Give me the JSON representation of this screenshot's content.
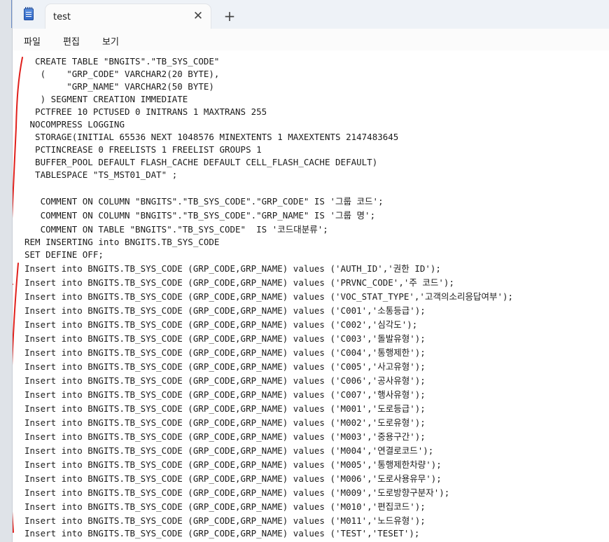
{
  "window": {
    "tab_title": "test",
    "close_glyph": "✕",
    "new_tab_glyph": "+"
  },
  "menu": {
    "items": [
      "파일",
      "편집",
      "보기"
    ]
  },
  "editor": {
    "lines": [
      "  CREATE TABLE \"BNGITS\".\"TB_SYS_CODE\"",
      "   (    \"GRP_CODE\" VARCHAR2(20 BYTE),",
      "        \"GRP_NAME\" VARCHAR2(50 BYTE)",
      "   ) SEGMENT CREATION IMMEDIATE",
      "  PCTFREE 10 PCTUSED 0 INITRANS 1 MAXTRANS 255",
      " NOCOMPRESS LOGGING",
      "  STORAGE(INITIAL 65536 NEXT 1048576 MINEXTENTS 1 MAXEXTENTS 2147483645",
      "  PCTINCREASE 0 FREELISTS 1 FREELIST GROUPS 1",
      "  BUFFER_POOL DEFAULT FLASH_CACHE DEFAULT CELL_FLASH_CACHE DEFAULT)",
      "  TABLESPACE \"TS_MST01_DAT\" ;",
      "",
      "   COMMENT ON COLUMN \"BNGITS\".\"TB_SYS_CODE\".\"GRP_CODE\" IS '그룹 코드';",
      "   COMMENT ON COLUMN \"BNGITS\".\"TB_SYS_CODE\".\"GRP_NAME\" IS '그룹 명';",
      "   COMMENT ON TABLE \"BNGITS\".\"TB_SYS_CODE\"  IS '코드대분류';",
      "REM INSERTING into BNGITS.TB_SYS_CODE",
      "SET DEFINE OFF;",
      "Insert into BNGITS.TB_SYS_CODE (GRP_CODE,GRP_NAME) values ('AUTH_ID','권한 ID');",
      "Insert into BNGITS.TB_SYS_CODE (GRP_CODE,GRP_NAME) values ('PRVNC_CODE','주 코드');",
      "Insert into BNGITS.TB_SYS_CODE (GRP_CODE,GRP_NAME) values ('VOC_STAT_TYPE','고객의소리응답여부');",
      "Insert into BNGITS.TB_SYS_CODE (GRP_CODE,GRP_NAME) values ('C001','소통등급');",
      "Insert into BNGITS.TB_SYS_CODE (GRP_CODE,GRP_NAME) values ('C002','심각도');",
      "Insert into BNGITS.TB_SYS_CODE (GRP_CODE,GRP_NAME) values ('C003','돌발유형');",
      "Insert into BNGITS.TB_SYS_CODE (GRP_CODE,GRP_NAME) values ('C004','통행제한');",
      "Insert into BNGITS.TB_SYS_CODE (GRP_CODE,GRP_NAME) values ('C005','사고유형');",
      "Insert into BNGITS.TB_SYS_CODE (GRP_CODE,GRP_NAME) values ('C006','공사유형');",
      "Insert into BNGITS.TB_SYS_CODE (GRP_CODE,GRP_NAME) values ('C007','행사유형');",
      "Insert into BNGITS.TB_SYS_CODE (GRP_CODE,GRP_NAME) values ('M001','도로등급');",
      "Insert into BNGITS.TB_SYS_CODE (GRP_CODE,GRP_NAME) values ('M002','도로유형');",
      "Insert into BNGITS.TB_SYS_CODE (GRP_CODE,GRP_NAME) values ('M003','중용구간');",
      "Insert into BNGITS.TB_SYS_CODE (GRP_CODE,GRP_NAME) values ('M004','연결로코드');",
      "Insert into BNGITS.TB_SYS_CODE (GRP_CODE,GRP_NAME) values ('M005','통행제한차량');",
      "Insert into BNGITS.TB_SYS_CODE (GRP_CODE,GRP_NAME) values ('M006','도로사용유무');",
      "Insert into BNGITS.TB_SYS_CODE (GRP_CODE,GRP_NAME) values ('M009','도로방향구분자');",
      "Insert into BNGITS.TB_SYS_CODE (GRP_CODE,GRP_NAME) values ('M010','편집코드');",
      "Insert into BNGITS.TB_SYS_CODE (GRP_CODE,GRP_NAME) values ('M011','노드유형');",
      "Insert into BNGITS.TB_SYS_CODE (GRP_CODE,GRP_NAME) values ('TEST','TESET');"
    ]
  },
  "colors": {
    "annotation": "#e0201c",
    "tabstrip": "#eef2f7",
    "editor_bg": "#ffffff"
  }
}
